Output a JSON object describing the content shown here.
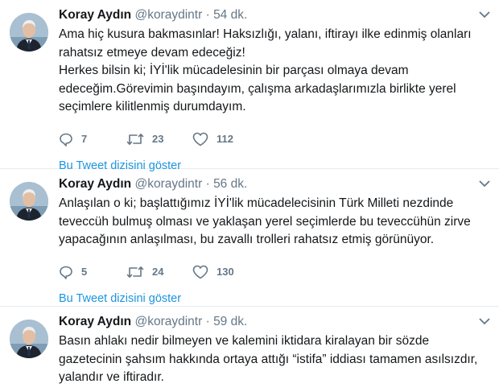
{
  "tweets": [
    {
      "name": "Koray Aydın",
      "handle": "@koraydintr",
      "separator": "·",
      "time": "54 dk.",
      "paragraphs": [
        "Ama hiç kusura bakmasınlar! Haksızlığı, yalanı, iftirayı ilke edinmiş olanları rahatsız etmeye devam edeceğiz!",
        "Herkes bilsin ki; İYİ'lik mücadelesinin bir parçası olmaya devam edeceğim.Görevimin başındayım, çalışma arkadaşlarımızla birlikte yerel seçimlere kilitlenmiş durumdayım."
      ],
      "replies": "7",
      "retweets": "23",
      "likes": "112",
      "thread_link": "Bu Tweet dizisini göster"
    },
    {
      "name": "Koray Aydın",
      "handle": "@koraydintr",
      "separator": "·",
      "time": "56 dk.",
      "paragraphs": [
        "Anlaşılan o ki; başlattığımız İYİ'lik mücadelecisinin Türk Milleti nezdinde teveccüh bulmuş olması ve yaklaşan yerel seçimlerde bu teveccühün zirve yapacağının anlaşılması, bu zavallı trolleri rahatsız etmiş görünüyor."
      ],
      "replies": "5",
      "retweets": "24",
      "likes": "130",
      "thread_link": "Bu Tweet dizisini göster"
    },
    {
      "name": "Koray Aydın",
      "handle": "@koraydintr",
      "separator": "·",
      "time": "59 dk.",
      "paragraphs": [
        "Basın ahlakı nedir bilmeyen ve kalemini iktidara kiralayan bir sözde gazetecinin şahsım hakkında ortaya attığı “istifa” iddiası tamamen asılsızdır, yalandır ve iftiradır."
      ]
    }
  ],
  "colors": {
    "link": "#1b95e0",
    "secondary_text": "#657786",
    "divider": "#e6ecf0"
  },
  "icons": {
    "reply": "reply-icon",
    "retweet": "retweet-icon",
    "like": "heart-icon",
    "menu": "chevron-down-icon"
  }
}
